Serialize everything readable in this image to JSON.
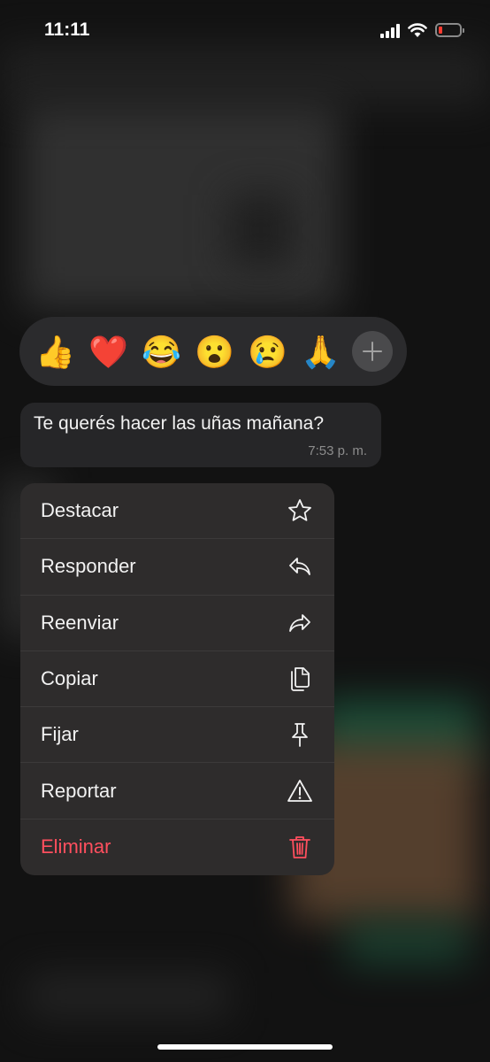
{
  "status_bar": {
    "time": "11:11"
  },
  "reaction_bar": {
    "emojis": [
      {
        "glyph": "👍",
        "name": "thumbs-up-emoji"
      },
      {
        "glyph": "❤️",
        "name": "heart-emoji"
      },
      {
        "glyph": "😂",
        "name": "tears-of-joy-emoji"
      },
      {
        "glyph": "😮",
        "name": "surprised-emoji"
      },
      {
        "glyph": "😢",
        "name": "crying-emoji"
      },
      {
        "glyph": "🙏",
        "name": "folded-hands-emoji"
      }
    ],
    "more_icon": "plus-icon"
  },
  "message": {
    "text": "Te querés hacer las uñas mañana?",
    "time": "7:53 p. m."
  },
  "menu": {
    "items": [
      {
        "label": "Destacar",
        "icon": "star-icon"
      },
      {
        "label": "Responder",
        "icon": "reply-icon"
      },
      {
        "label": "Reenviar",
        "icon": "forward-icon"
      },
      {
        "label": "Copiar",
        "icon": "copy-icon"
      },
      {
        "label": "Fijar",
        "icon": "pin-icon"
      },
      {
        "label": "Reportar",
        "icon": "warning-icon"
      },
      {
        "label": "Eliminar",
        "icon": "trash-icon",
        "destructive": true
      }
    ]
  },
  "colors": {
    "destructive": "#ff4f5e",
    "battery_low": "#ff3b30"
  }
}
